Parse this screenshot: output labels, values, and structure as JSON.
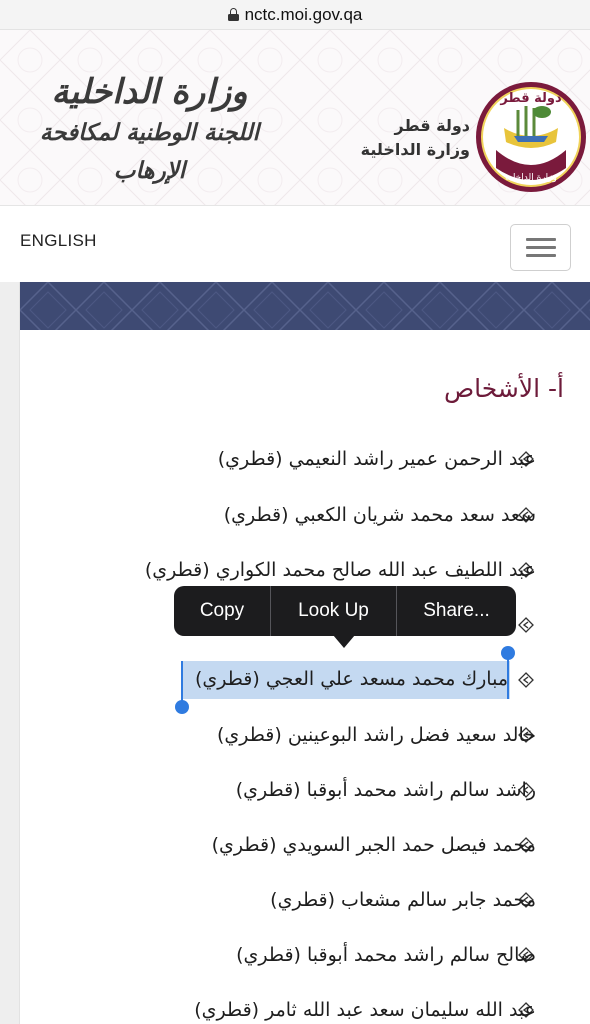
{
  "browser": {
    "url": "nctc.moi.gov.qa"
  },
  "header": {
    "ministry_line1": "وزارة الداخلية",
    "ministry_line2": "اللجنة الوطنية لمكافحة الإرهاب",
    "state_line1": "دولة قطر",
    "state_line2": "وزارة الداخلية",
    "emblem_label": "دولة قطر",
    "emblem_ring_text": "وزارة الداخلية"
  },
  "nav": {
    "language_link": "ENGLISH",
    "menu_icon": "hamburger-icon"
  },
  "content": {
    "section_heading": "أ- الأشخاص",
    "bullet_icon": "arrow-bullet-icon",
    "persons": [
      "عبد الرحمن عمير راشد النعيمي (قطري)",
      "سعد سعد محمد شريان الكعبي (قطري)",
      "عبد اللطيف عبد الله صالح محمد الكواري (قطري)",
      "",
      "مبارك محمد مسعد علي العجي (قطري)",
      "خالد سعيد فضل راشد البوعينين (قطري)",
      "راشد سالم راشد محمد أبوقبا (قطري)",
      "محمد فيصل حمد الجبر السويدي (قطري)",
      "محمد جابر سالم مشعاب (قطري)",
      "صالح سالم راشد محمد أبوقبا (قطري)",
      "عبد الله سليمان سعد عبد الله ثامر (قطري)"
    ]
  },
  "context_menu": {
    "items": [
      "Copy",
      "Look Up",
      "Share..."
    ]
  },
  "colors": {
    "banner": "#3e4a73",
    "heading": "#6d1b3a",
    "selection": "#c4d9f1",
    "handle": "#2f7be0",
    "maroon": "#7a1a3c"
  }
}
